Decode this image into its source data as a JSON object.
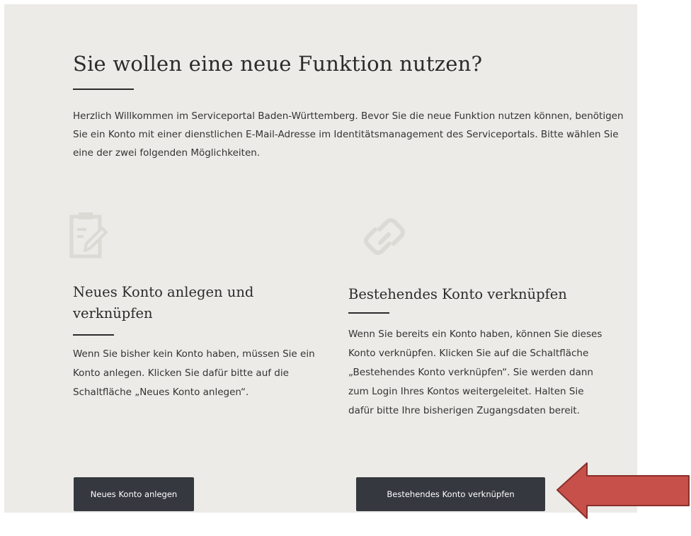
{
  "page": {
    "title": "Sie wollen eine neue Funktion nutzen?",
    "intro": "Herzlich Willkommen im Serviceportal Baden-Württemberg. Bevor Sie die neue Funktion nutzen können, benötigen Sie ein Konto mit einer dienstlichen E-Mail-Adresse im Identitätsmanagement des Serviceportals. Bitte wählen Sie eine der zwei folgenden Möglichkeiten."
  },
  "options": [
    {
      "icon": "clipboard-edit-icon",
      "heading": "Neues Konto anlegen und verknüpfen",
      "text": "Wenn Sie bisher kein Konto haben, müssen Sie ein Konto anlegen. Klicken Sie dafür bitte auf die Schaltfläche „Neues Konto anlegen“.",
      "button_label": "Neues Konto anlegen"
    },
    {
      "icon": "link-icon",
      "heading": "Bestehendes Konto verknüpfen",
      "text": "Wenn Sie bereits ein Konto haben, können Sie dieses Konto verknüpfen. Klicken Sie auf die Schaltfläche „Bestehendes Konto verknüpfen“. Sie werden dann zum Login Ihres Kontos weitergeleitet. Halten Sie dafür bitte Ihre bisherigen Zugangsdaten bereit.",
      "button_label": "Bestehendes Konto verknüpfen"
    }
  ],
  "annotation": {
    "icon": "left-arrow-icon",
    "color": "#c8504a"
  },
  "colors": {
    "panel_background": "#ecebe7",
    "button_background": "#363840",
    "text": "#333333"
  }
}
